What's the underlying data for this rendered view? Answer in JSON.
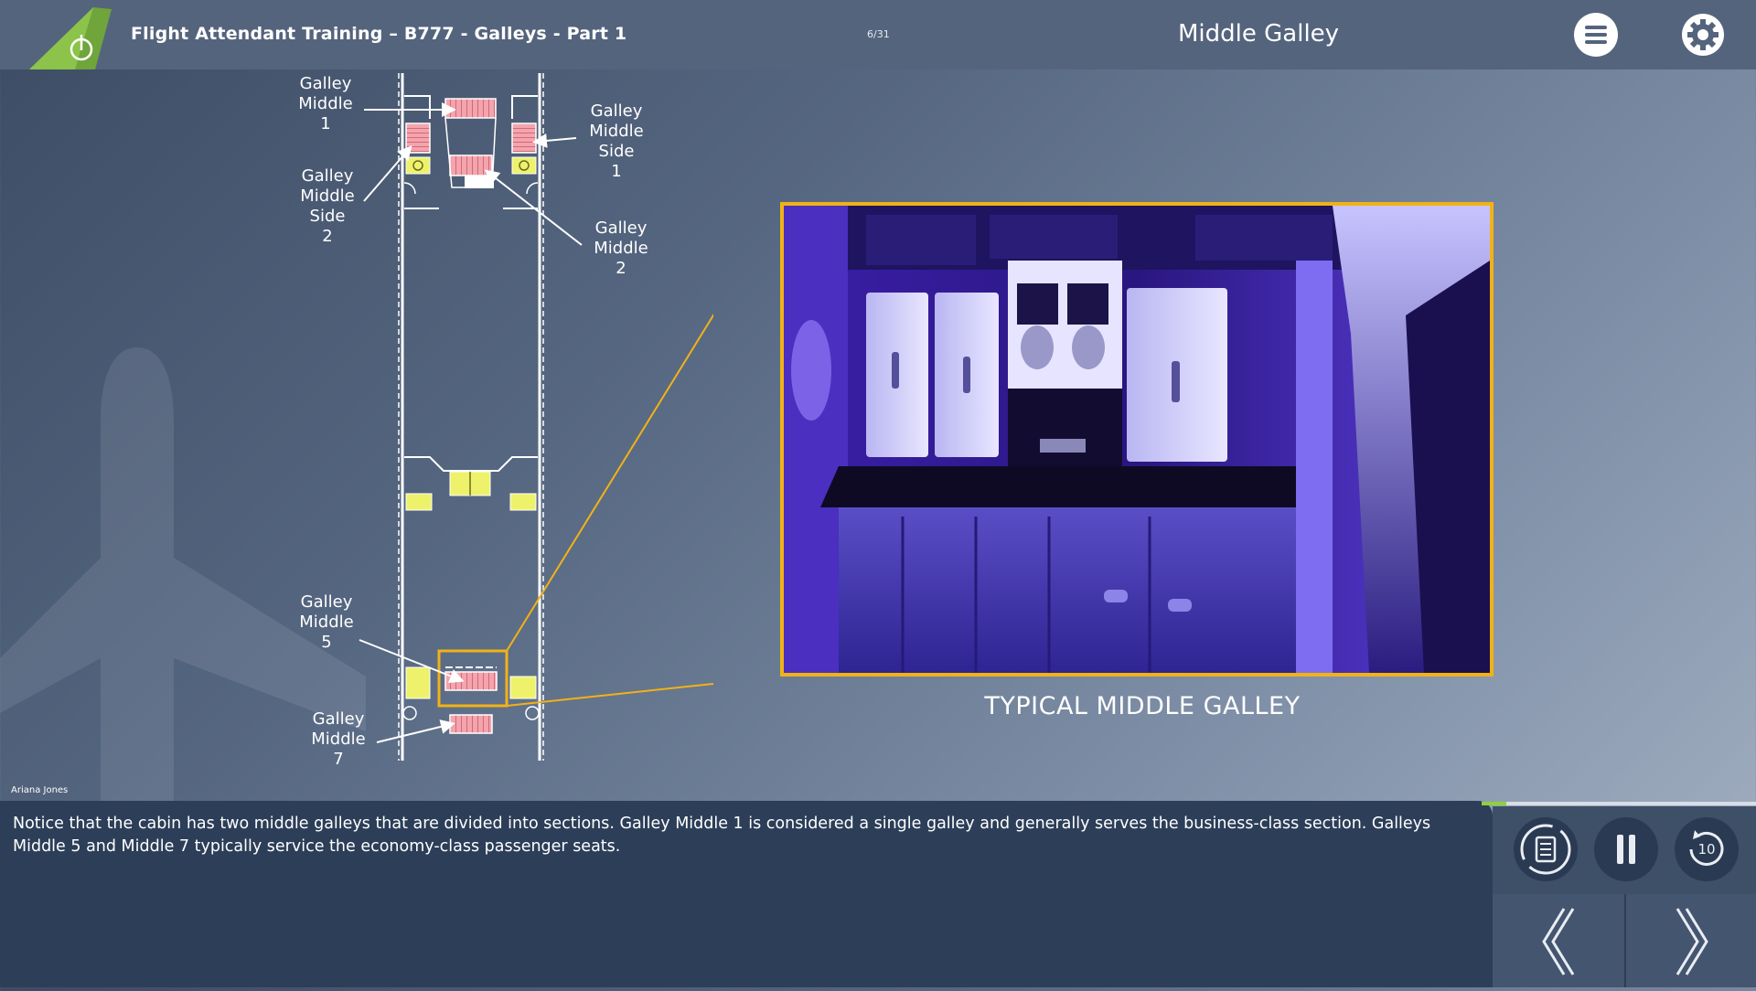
{
  "header": {
    "course_title": "Flight Attendant Training – B777 - Galleys - Part 1",
    "page_counter": "6/31",
    "page_title": "Middle Galley",
    "menu_icon": "hamburger-menu-icon",
    "settings_icon": "gear-icon"
  },
  "diagram": {
    "labels": {
      "galley_middle_1": [
        "Galley",
        "Middle",
        "1"
      ],
      "galley_middle_side_1": [
        "Galley",
        "Middle",
        "Side",
        "1"
      ],
      "galley_middle_side_2": [
        "Galley",
        "Middle",
        "Side",
        "2"
      ],
      "galley_middle_2": [
        "Galley",
        "Middle",
        "2"
      ],
      "galley_middle_5": [
        "Galley",
        "Middle",
        "5"
      ],
      "galley_middle_7": [
        "Galley",
        "Middle",
        "7"
      ]
    }
  },
  "photo": {
    "caption": "TYPICAL MIDDLE GALLEY"
  },
  "presenter_name": "Ariana Jones",
  "narration": "Notice that the cabin has two middle galleys that are divided into sections. Galley Middle 1 is considered a single galley and generally serves the business-class section. Galleys Middle 5 and Middle 7 typically service the economy-class passenger seats.",
  "player": {
    "progress_fraction": 0.09,
    "transcript_icon": "transcript-refresh-icon",
    "pause_icon": "pause-icon",
    "rewind_icon": "rewind-10-icon",
    "rewind_seconds": "10",
    "prev_icon": "chevron-left-icon",
    "next_icon": "chevron-right-icon"
  },
  "colors": {
    "header_bg": "#55647d",
    "caption_bg": "#2c3e58",
    "accent_orange": "#f2b216",
    "accent_green": "#8fd238",
    "galley_pink": "#f2a0aa",
    "galley_yellow": "#eef26a"
  }
}
